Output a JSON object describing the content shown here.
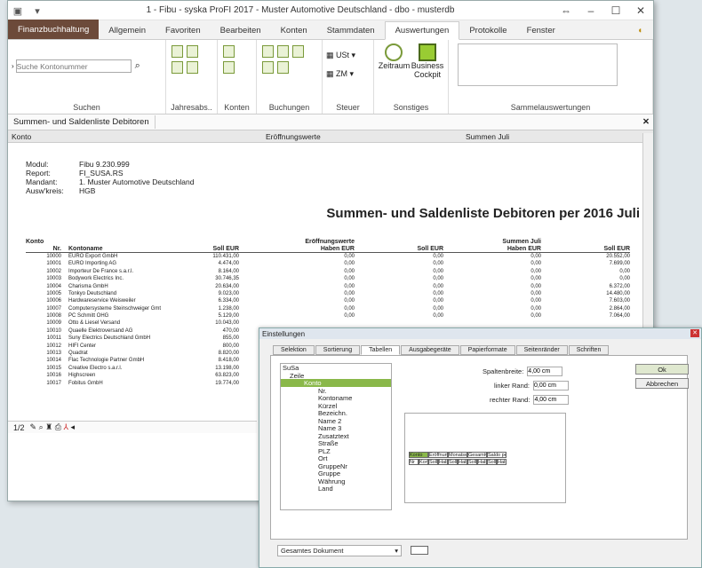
{
  "window": {
    "title": "1 - Fibu - syska ProFI 2017 - Muster Automotive Deutschland - dbo - musterdb",
    "icons": [
      "app-icon",
      "quick-access-icon"
    ]
  },
  "tabs": [
    "Finanzbuchhaltung",
    "Allgemein",
    "Favoriten",
    "Bearbeiten",
    "Konten",
    "Stammdaten",
    "Auswertungen",
    "Protokolle",
    "Fenster"
  ],
  "ribbon": {
    "search_placeholder": "Suche Kontonummer",
    "groups": [
      "Suchen",
      "Jahresabs..",
      "Konten",
      "Buchungen",
      "Steuer",
      "Sonstiges",
      "Sammelauswertungen"
    ],
    "ust": "USt",
    "zm": "ZM",
    "zeitraum": "Zeitraum",
    "cockpit1": "Business",
    "cockpit2": "Cockpit"
  },
  "doc_tab": "Summen- und Saldenliste Debitoren",
  "header": {
    "konto": "Konto",
    "eroeff": "Eröffnungswerte",
    "summen": "Summen Juli"
  },
  "meta": [
    [
      "Modul:",
      "Fibu 9.230.999"
    ],
    [
      "Report:",
      "FI_SUSA.RS"
    ],
    [
      "Mandant:",
      "1. Muster Automotive Deutschland"
    ],
    [
      "Ausw'kreis:",
      "HGB"
    ]
  ],
  "report_title": "Summen- und Saldenliste Debitoren per 2016 Juli",
  "table_head1": [
    "Konto",
    "",
    "",
    "Eröffnungswerte",
    "",
    "Summen Juli",
    ""
  ],
  "table_head2": [
    "Nr.",
    "Kontoname",
    "Soll EUR",
    "Haben EUR",
    "Soll EUR",
    "Haben EUR",
    "Soll EUR"
  ],
  "rows": [
    [
      "10000",
      "EURO Export GmbH",
      "110.431,00",
      "0,00",
      "0,00",
      "0,00",
      "20.552,00"
    ],
    [
      "10001",
      "EURO Importing AG",
      "4.474,00",
      "0,00",
      "0,00",
      "0,00",
      "7.699,00"
    ],
    [
      "10002",
      "Importeur De France s.a.r.l.",
      "8.164,00",
      "0,00",
      "0,00",
      "0,00",
      "0,00"
    ],
    [
      "10003",
      "Bodywork Electrics Inc.",
      "30.746,35",
      "0,00",
      "0,00",
      "0,00",
      "0,00"
    ],
    [
      "10004",
      "Charisma GmbH",
      "20.634,00",
      "0,00",
      "0,00",
      "0,00",
      "6.372,00"
    ],
    [
      "10005",
      "Tonkyo Deutschland",
      "9.023,00",
      "0,00",
      "0,00",
      "0,00",
      "14.480,00"
    ],
    [
      "10006",
      "Hardwareservice Weisweiler",
      "6.334,00",
      "0,00",
      "0,00",
      "0,00",
      "7.603,00"
    ],
    [
      "10007",
      "Computersysteme Steinschweiger Gmt",
      "1.238,00",
      "0,00",
      "0,00",
      "0,00",
      "2.864,00"
    ],
    [
      "10008",
      "PC Schmitt OHG",
      "5.129,00",
      "0,00",
      "0,00",
      "0,00",
      "7.064,00"
    ],
    [
      "10009",
      "Otto & Liesel Versand",
      "10.043,00",
      "",
      "",
      "",
      ""
    ],
    [
      "10010",
      "Quaelle Elektroversand AG",
      "470,00",
      "",
      "",
      "",
      ""
    ],
    [
      "10011",
      "Suny Electrics Deutschland GmbH",
      "855,00",
      "",
      "",
      "",
      ""
    ],
    [
      "10012",
      "HIFI Center",
      "800,00",
      "",
      "",
      "",
      ""
    ],
    [
      "10013",
      "Quadrat",
      "8.820,00",
      "",
      "",
      "",
      ""
    ],
    [
      "10014",
      "Flac Technologie Partner GmbH",
      "8.418,00",
      "",
      "",
      "",
      ""
    ],
    [
      "10015",
      "Creative Electro s.a.r.l.",
      "13.198,00",
      "",
      "",
      "",
      ""
    ],
    [
      "10016",
      "Highscreen",
      "63.823,00",
      "",
      "",
      "",
      ""
    ],
    [
      "10017",
      "Fobitus GmbH",
      "19.774,00",
      "",
      "",
      "",
      ""
    ]
  ],
  "status": {
    "page": "1/2"
  },
  "dialog": {
    "title": "Einstellungen",
    "tabs": [
      "Selektion",
      "Sortierung",
      "Tabellen",
      "Ausgabegeräte",
      "Papierformate",
      "Seitenränder",
      "Schriften"
    ],
    "tree": [
      "SuSa",
      "Zeile",
      "Konto",
      "Nr.",
      "Kontoname",
      "Kürzel",
      "Bezeichn.",
      "Name 2",
      "Name 3",
      "Zusatztext",
      "Straße",
      "PLZ",
      "Ort",
      "GruppeNr",
      "Gruppe",
      "Währung",
      "Land"
    ],
    "spaltenbreite_label": "Spaltenbreite:",
    "spaltenbreite": "4,00 cm",
    "linker_label": "linker Rand:",
    "linker": "0,00 cm",
    "rechter_label": "rechter Rand:",
    "rechter": "4,00 cm",
    "ok": "Ok",
    "abbrechen": "Abbrechen",
    "preview_top": [
      "Konto",
      "Eröffnung",
      "Monatswe",
      "Gesamtwe",
      "Saldo per"
    ],
    "preview_bot": [
      "Nr",
      "Kont",
      "Soll",
      "Habe",
      "Soll",
      "Habe",
      "Soll",
      "Habe",
      "Soll",
      "Habe"
    ],
    "scope": "Gesamtes Dokument"
  }
}
